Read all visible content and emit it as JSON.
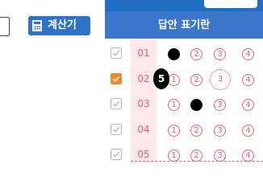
{
  "calculator": {
    "label": "계산기",
    "icon": "calculator-icon"
  },
  "answer_sheet": {
    "title": "답안 표기란",
    "choice_labels": [
      "1",
      "2",
      "3",
      "4"
    ],
    "rows": [
      {
        "num": "01",
        "checked": false,
        "filled": [
          1
        ],
        "highlight": null,
        "badge": null
      },
      {
        "num": "02",
        "checked": true,
        "filled": [],
        "highlight": 3,
        "badge": "5"
      },
      {
        "num": "03",
        "checked": false,
        "filled": [
          2
        ],
        "highlight": null,
        "badge": null
      },
      {
        "num": "04",
        "checked": false,
        "filled": [],
        "highlight": null,
        "badge": null
      },
      {
        "num": "05",
        "checked": false,
        "filled": [],
        "highlight": null,
        "badge": null
      }
    ]
  },
  "colors": {
    "header_blue": "#3a76c9",
    "accent_orange": "#f08a2a",
    "pink_bg": "#fde9ea",
    "choice_red": "#e4646a"
  }
}
